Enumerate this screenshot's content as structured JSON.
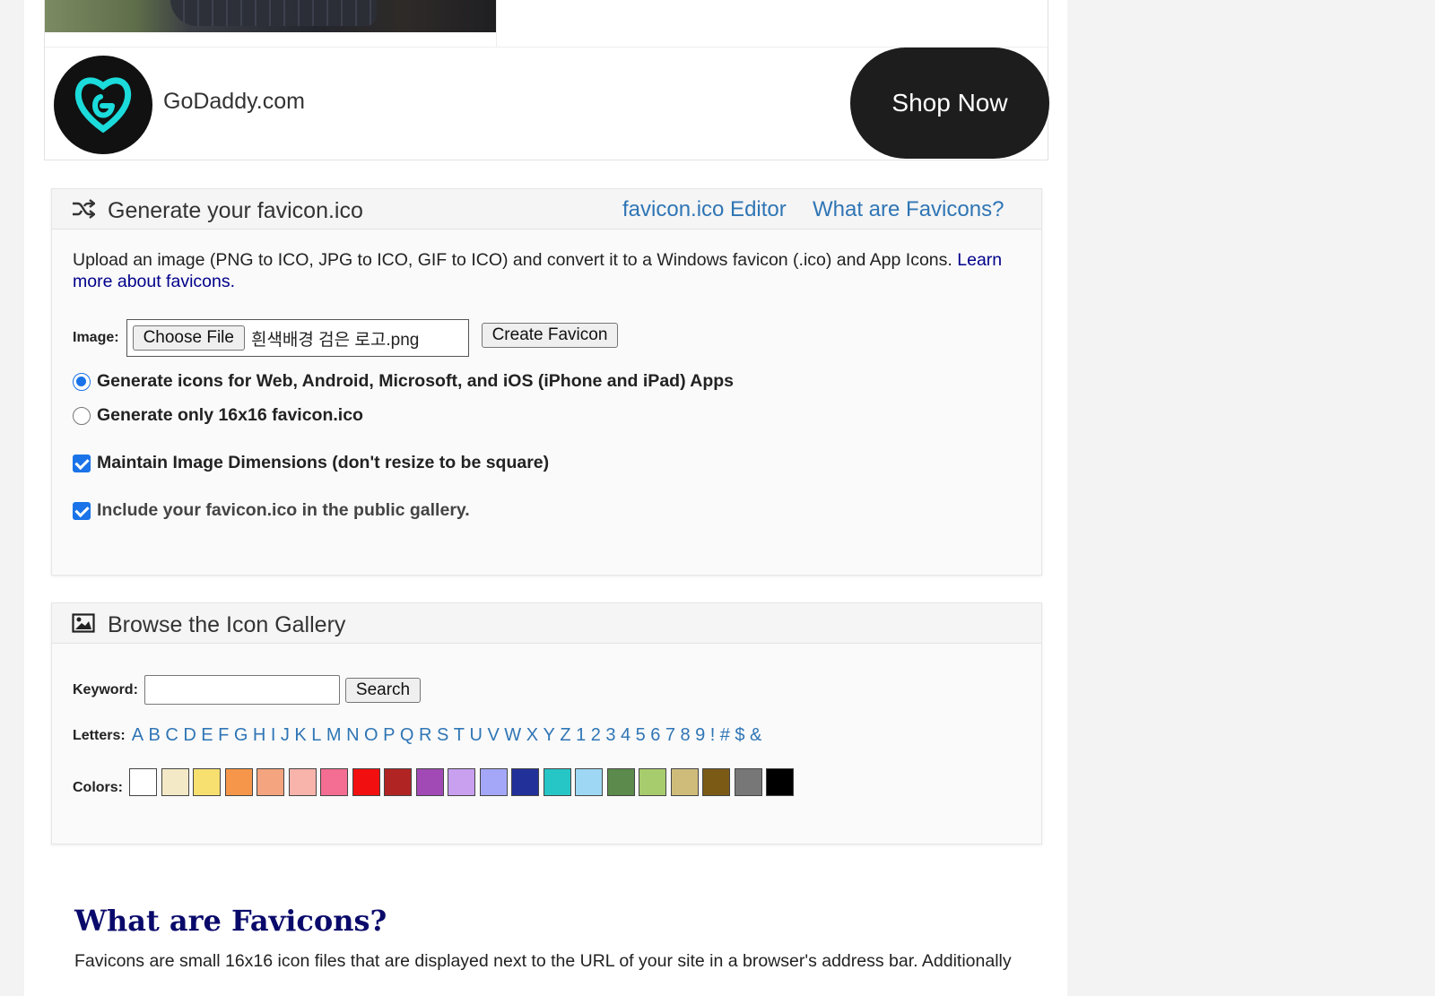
{
  "ad": {
    "brand": "GoDaddy.com",
    "cta": "Shop Now"
  },
  "generate_panel": {
    "title": "Generate your favicon.ico",
    "link_editor": "favicon.ico Editor",
    "link_what": "What are Favicons?",
    "description": "Upload an image (PNG to ICO, JPG to ICO, GIF to ICO) and convert it to a Windows favicon (.ico) and App Icons. ",
    "learn_more": "Learn more about favicons.",
    "image_label": "Image:",
    "choose_file": "Choose File",
    "file_name": "흰색배경 검은 로고.png",
    "create_button": "Create Favicon",
    "option_all": "Generate icons for Web, Android, Microsoft, and iOS (iPhone and iPad) Apps",
    "option_16": "Generate only 16x16 favicon.ico",
    "maintain_dims": "Maintain Image Dimensions (don't resize to be square)",
    "include_gallery": "Include your favicon.ico in the public gallery.",
    "selected_option": "option_all",
    "maintain_checked": true,
    "include_checked": true
  },
  "gallery_panel": {
    "title": "Browse the Icon Gallery",
    "keyword_label": "Keyword:",
    "keyword_value": "",
    "search_button": "Search",
    "letters_label": "Letters:",
    "letters": [
      "A",
      "B",
      "C",
      "D",
      "E",
      "F",
      "G",
      "H",
      "I",
      "J",
      "K",
      "L",
      "M",
      "N",
      "O",
      "P",
      "Q",
      "R",
      "S",
      "T",
      "U",
      "V",
      "W",
      "X",
      "Y",
      "Z",
      "1",
      "2",
      "3",
      "4",
      "5",
      "6",
      "7",
      "8",
      "9",
      "!",
      "#",
      "$",
      "&"
    ],
    "colors_label": "Colors:",
    "colors": [
      "#ffffff",
      "#f3e9c6",
      "#f7e070",
      "#f6964a",
      "#f4a57f",
      "#f8b3ab",
      "#f46d92",
      "#f20f0f",
      "#b12424",
      "#a14ab5",
      "#c99ff0",
      "#a4a7f8",
      "#22309a",
      "#26c6c6",
      "#9dd7f3",
      "#5b8a4c",
      "#a7cc6d",
      "#cfbc7b",
      "#7b5a16",
      "#777777",
      "#000000"
    ]
  },
  "article": {
    "heading": "What are Favicons?",
    "paragraph": "Favicons are small 16x16 icon files that are displayed next to the URL of your site in a browser's address bar. Additionally"
  }
}
